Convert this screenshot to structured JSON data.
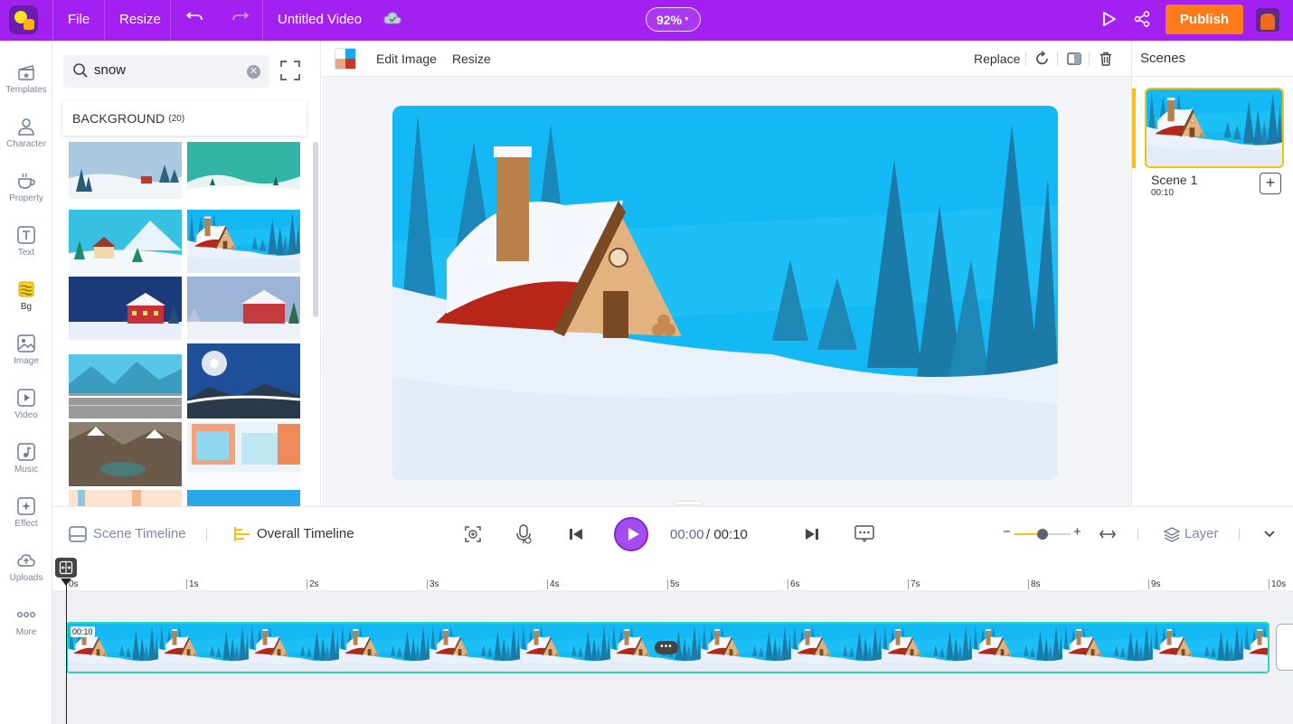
{
  "topbar": {
    "file": "File",
    "resize": "Resize",
    "title": "Untitled Video",
    "zoom": "92%",
    "publish": "Publish"
  },
  "rail": [
    {
      "label": "Templates",
      "icon": "templates-icon"
    },
    {
      "label": "Character",
      "icon": "character-icon"
    },
    {
      "label": "Property",
      "icon": "property-icon"
    },
    {
      "label": "Text",
      "icon": "text-icon"
    },
    {
      "label": "Bg",
      "icon": "bg-icon"
    },
    {
      "label": "Image",
      "icon": "image-icon"
    },
    {
      "label": "Video",
      "icon": "video-icon"
    },
    {
      "label": "Music",
      "icon": "music-icon"
    },
    {
      "label": "Effect",
      "icon": "effect-icon"
    },
    {
      "label": "Uploads",
      "icon": "uploads-icon"
    },
    {
      "label": "More",
      "icon": "more-icon"
    }
  ],
  "search": {
    "value": "snow"
  },
  "category": {
    "title": "BACKGROUND",
    "count": "(20)"
  },
  "editor_toolbar": {
    "edit_image": "Edit Image",
    "resize": "Resize",
    "replace": "Replace"
  },
  "scenes": {
    "title": "Scenes",
    "items": [
      {
        "name": "Scene 1",
        "duration": "00:10"
      }
    ]
  },
  "timeline": {
    "scene_timeline": "Scene Timeline",
    "overall_timeline": "Overall Timeline",
    "current": "00:00",
    "separator": "/",
    "total": "00:10",
    "layer": "Layer",
    "ticks": [
      "0s",
      "1s",
      "2s",
      "3s",
      "4s",
      "5s",
      "6s",
      "7s",
      "8s",
      "9s",
      "10s"
    ],
    "track_time": "00:10"
  },
  "colors": {
    "topbar": "#a321f0",
    "publish": "#ff7a1a",
    "accent": "#f6c012",
    "play": "#a44cf0",
    "track_border": "#2ed6b0"
  }
}
